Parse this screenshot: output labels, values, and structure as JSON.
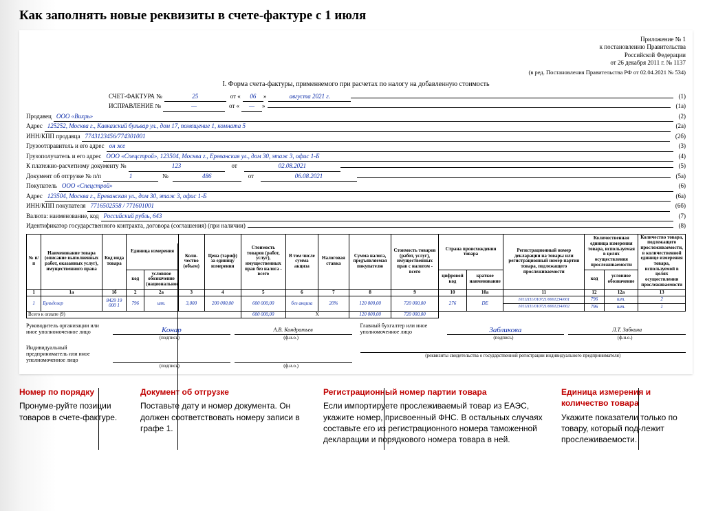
{
  "page_title": "Как заполнять новые реквизиты в счете-фактуре с 1 июля",
  "annex": {
    "l1": "Приложение № 1",
    "l2": "к постановлению Правительства",
    "l3": "Российской Федерации",
    "l4": "от 26 декабря 2011 г. № 1137",
    "amend": "(в ред. Постановления Правительства РФ от 02.04.2021 № 534)"
  },
  "form_title": "I. Форма счета-фактуры, применяемого при расчетах по налогу на добавленную стоимость",
  "inv": {
    "label": "СЧЕТ-ФАКТУРА  №",
    "no": "25",
    "from": "от «",
    "day": "06",
    "close": "»",
    "month_year": "августа 2021 г.",
    "code": "(1)"
  },
  "corr": {
    "label": "ИСПРАВЛЕНИЕ  №",
    "no": "—",
    "from": "от «",
    "day": "—",
    "close": "»",
    "month_year": "",
    "code": "(1а)"
  },
  "fields": {
    "seller_lbl": "Продавец",
    "seller_val": "ООО «Вихрь»",
    "seller_code": "(2)",
    "addr_lbl": "Адрес",
    "addr_val": "125252, Москва г., Кавказский бульвар ул., дом 17, помещение 1, комната 5",
    "addr_code": "(2а)",
    "inn_lbl": "ИНН/КПП продавца",
    "inn_val": "7743123456/774301001",
    "inn_code": "(2б)",
    "shipper_lbl": "Грузоотправитель и его адрес",
    "shipper_val": "он же",
    "shipper_code": "(3)",
    "consignee_lbl": "Грузополучатель и его адрес",
    "consignee_val": "ООО «Спецстрой», 123504, Москва г., Ереванская ул., дом 30, этаж 3, офис 1-Б",
    "consignee_code": "(4)",
    "paydoc_lbl": "К платежно-расчетному документу №",
    "paydoc_no": "123",
    "paydoc_from": "от",
    "paydoc_date": "02.08.2021",
    "paydoc_code": "(5)",
    "shipdoc_lbl": "Документ об отгрузке № п/п",
    "shipdoc_pp": "1",
    "shipdoc_no_lbl": "№",
    "shipdoc_no": "486",
    "shipdoc_from": "от",
    "shipdoc_date": "06.08.2021",
    "shipdoc_code": "(5а)",
    "buyer_lbl": "Покупатель",
    "buyer_val": "ООО «Спецстрой»",
    "buyer_code": "(6)",
    "baddr_lbl": "Адрес",
    "baddr_val": "123504, Москва г., Ереванская ул., дом 30, этаж 3, офис 1-Б",
    "baddr_code": "(6а)",
    "binn_lbl": "ИНН/КПП покупателя",
    "binn_val": "7716502558 / 771601001",
    "binn_code": "(6б)",
    "curr_lbl": "Валюта: наименование, код",
    "curr_val": "Российский рубль, 643",
    "curr_code": "(7)",
    "contract_lbl": "Идентификатор государственного контракта, договора (соглашения) (при наличии)",
    "contract_val": "",
    "contract_code": "(8)"
  },
  "th": {
    "c1": "№ п/п",
    "c1a": "Наименование товара (описание выполненных работ, оказанных услуг), имущественного права",
    "c1b": "Код вида товара",
    "c2": "Единица измерения",
    "c2_k": "код",
    "c2_n": "условное обозначение (национальное)",
    "c3": "Коли-чество (объем)",
    "c4": "Цена (тариф) за единицу измерения",
    "c5": "Стоимость товаров (работ, услуг), имущественных прав без налога - всего",
    "c6": "В том числе сумма акциза",
    "c7": "Налоговая ставка",
    "c8": "Сумма налога, предъявляемая покупателю",
    "c9": "Стоимость товаров (работ, услуг), имущественных прав с налогом - всего",
    "c10": "Страна происхождения товара",
    "c10_k": "цифровой код",
    "c10_n": "краткое наименование",
    "c11": "Регистрационный номер декларации на товары или регистрационный номер партии товара, подлежащего прослеживаемости",
    "c12": "Количественная единица измерения товара, используемая в целях осуществления прослеживаемости",
    "c12_k": "код",
    "c12_n": "условное обозначение",
    "c13": "Количество товара, подлежащего прослеживаемости, в количественной единице измерения товара, используемой в целях осуществления прослеживаемости"
  },
  "colnums": {
    "c1": "1",
    "c1a": "1а",
    "c1b": "1б",
    "c2": "2",
    "c2a": "2а",
    "c3": "3",
    "c4": "4",
    "c5": "5",
    "c6": "6",
    "c7": "7",
    "c8": "8",
    "c9": "9",
    "c10": "10",
    "c10a": "10а",
    "c11": "11",
    "c12": "12",
    "c12a": "12а",
    "c13": "13"
  },
  "rows": [
    {
      "pp": "1",
      "name": "Бульдозер",
      "kind": "8429 19 000 1",
      "ucode": "796",
      "uname": "шт.",
      "qty": "3,000",
      "price": "200 000,00",
      "cost": "600 000,00",
      "excise": "без акциза",
      "rate": "20%",
      "tax": "120 000,00",
      "total": "720 000,00",
      "ccode": "276",
      "cname": "DE",
      "reg1": "10111111/010721/0001234/001",
      "reg2": "10111111/010721/0001234/002",
      "mcode": "796",
      "mname": "шт.",
      "mqty1": "2",
      "mqty2": "1"
    }
  ],
  "totals": {
    "label": "Всего к оплате (9)",
    "cost": "600 000,00",
    "x": "Х",
    "tax": "120 000,00",
    "total": "720 000,00"
  },
  "sig": {
    "head_lbl": "Руководитель организации или иное уполномоченное лицо",
    "head_sign": "Конар",
    "head_fio": "А.В. Кондратьев",
    "acc_lbl": "Главный бухгалтер или иное уполномоченное лицо",
    "acc_sign": "Забликова",
    "acc_fio": "Л.Т. Забкина",
    "ip_lbl": "Индивидуальный предприниматель или иное уполномоченное лицо",
    "sub_sign": "(подпись)",
    "sub_fio": "(ф.и.о.)",
    "reg_note": "(реквизиты свидетельства о государственной регистрации индивидуального предпринимателя)"
  },
  "hints": {
    "h1_t": "Номер по порядку",
    "h1_b": "Пронуме-руйте позиции товаров в счете-фактуре.",
    "h2_t": "Документ об отгрузке",
    "h2_b": "Поставьте дату и номер документа. Он должен соответствовать номеру записи в графе 1.",
    "h3_t": "Регистрационный номер партии товара",
    "h3_b": "Если импортируете прослеживаемый товар из ЕАЭС, укажите номер, присвоенный ФНС. В остальных случаях составьте его из регистрационного номера таможенной декларации и порядкового номера товара в ней.",
    "h4_t": "Единица измерения и количество товара",
    "h4_b": "Укажите показатели только по товару, который под-лежит прослеживаемости."
  }
}
